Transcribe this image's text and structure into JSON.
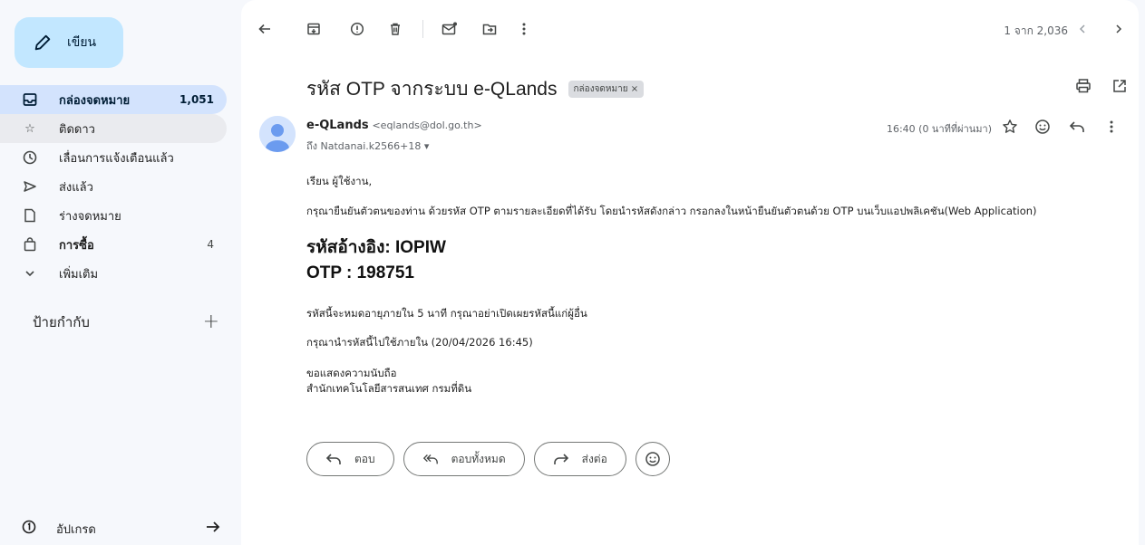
{
  "sidebar": {
    "compose_label": "เขียน",
    "items": [
      {
        "label": "กล่องจดหมาย",
        "count": "1,051"
      },
      {
        "label": "ติดดาว",
        "count": ""
      },
      {
        "label": "เลื่อนการแจ้งเตือนแล้ว",
        "count": ""
      },
      {
        "label": "ส่งแล้ว",
        "count": ""
      },
      {
        "label": "ร่างจดหมาย",
        "count": ""
      },
      {
        "label": "การซื้อ",
        "count": "4"
      },
      {
        "label": "เพิ่มเติม",
        "count": ""
      }
    ],
    "labels_heading": "ป้ายกำกับ",
    "labels_add": "+",
    "upgrade_label": "อัปเกรด"
  },
  "toolbar": {
    "pager_text": "1 จาก 2,036"
  },
  "email": {
    "subject": "รหัส OTP จากระบบ e-QLands",
    "tag": "กล่องจดหมาย ×",
    "sender_name": "e-QLands",
    "sender_addr": "<eqlands@dol.go.th>",
    "to": "ถึง Natdanai.k2566+18 ▾",
    "time": "16:40 (0 นาทีที่ผ่านมา)",
    "greeting": "เรียน ผู้ใช้งาน,",
    "intro": "กรุณายืนยันตัวตนของท่าน ด้วยรหัส OTP ตามรายละเอียดที่ได้รับ โดยนำรหัสดังกล่าว กรอกลงในหน้ายืนยันตัวตนด้วย OTP บนเว็บแอปพลิเคชัน(Web Application)",
    "ref_code": "รหัสอ้างอิง: IOPIW",
    "otp": "OTP : 198751",
    "expiry": "รหัสนี้จะหมดอายุภายใน 5 นาที กรุณาอย่าเปิดเผยรหัสนี้แก่ผู้อื่น",
    "use_before": "กรุณานำรหัสนี้ไปใช้ภายใน (20/04/2026 16:45)",
    "closing": "ขอแสดงความนับถือ",
    "signature": "สำนักเทคโนโลยีสารสนเทศ กรมที่ดิน"
  },
  "actions": {
    "reply": "ตอบ",
    "reply_all": "ตอบทั้งหมด",
    "forward": "ส่งต่อ"
  },
  "colors": {
    "compose_bg": "#c2e7ff",
    "active_nav_bg": "#d3e3fd",
    "page_bg": "#f6f8fc"
  }
}
